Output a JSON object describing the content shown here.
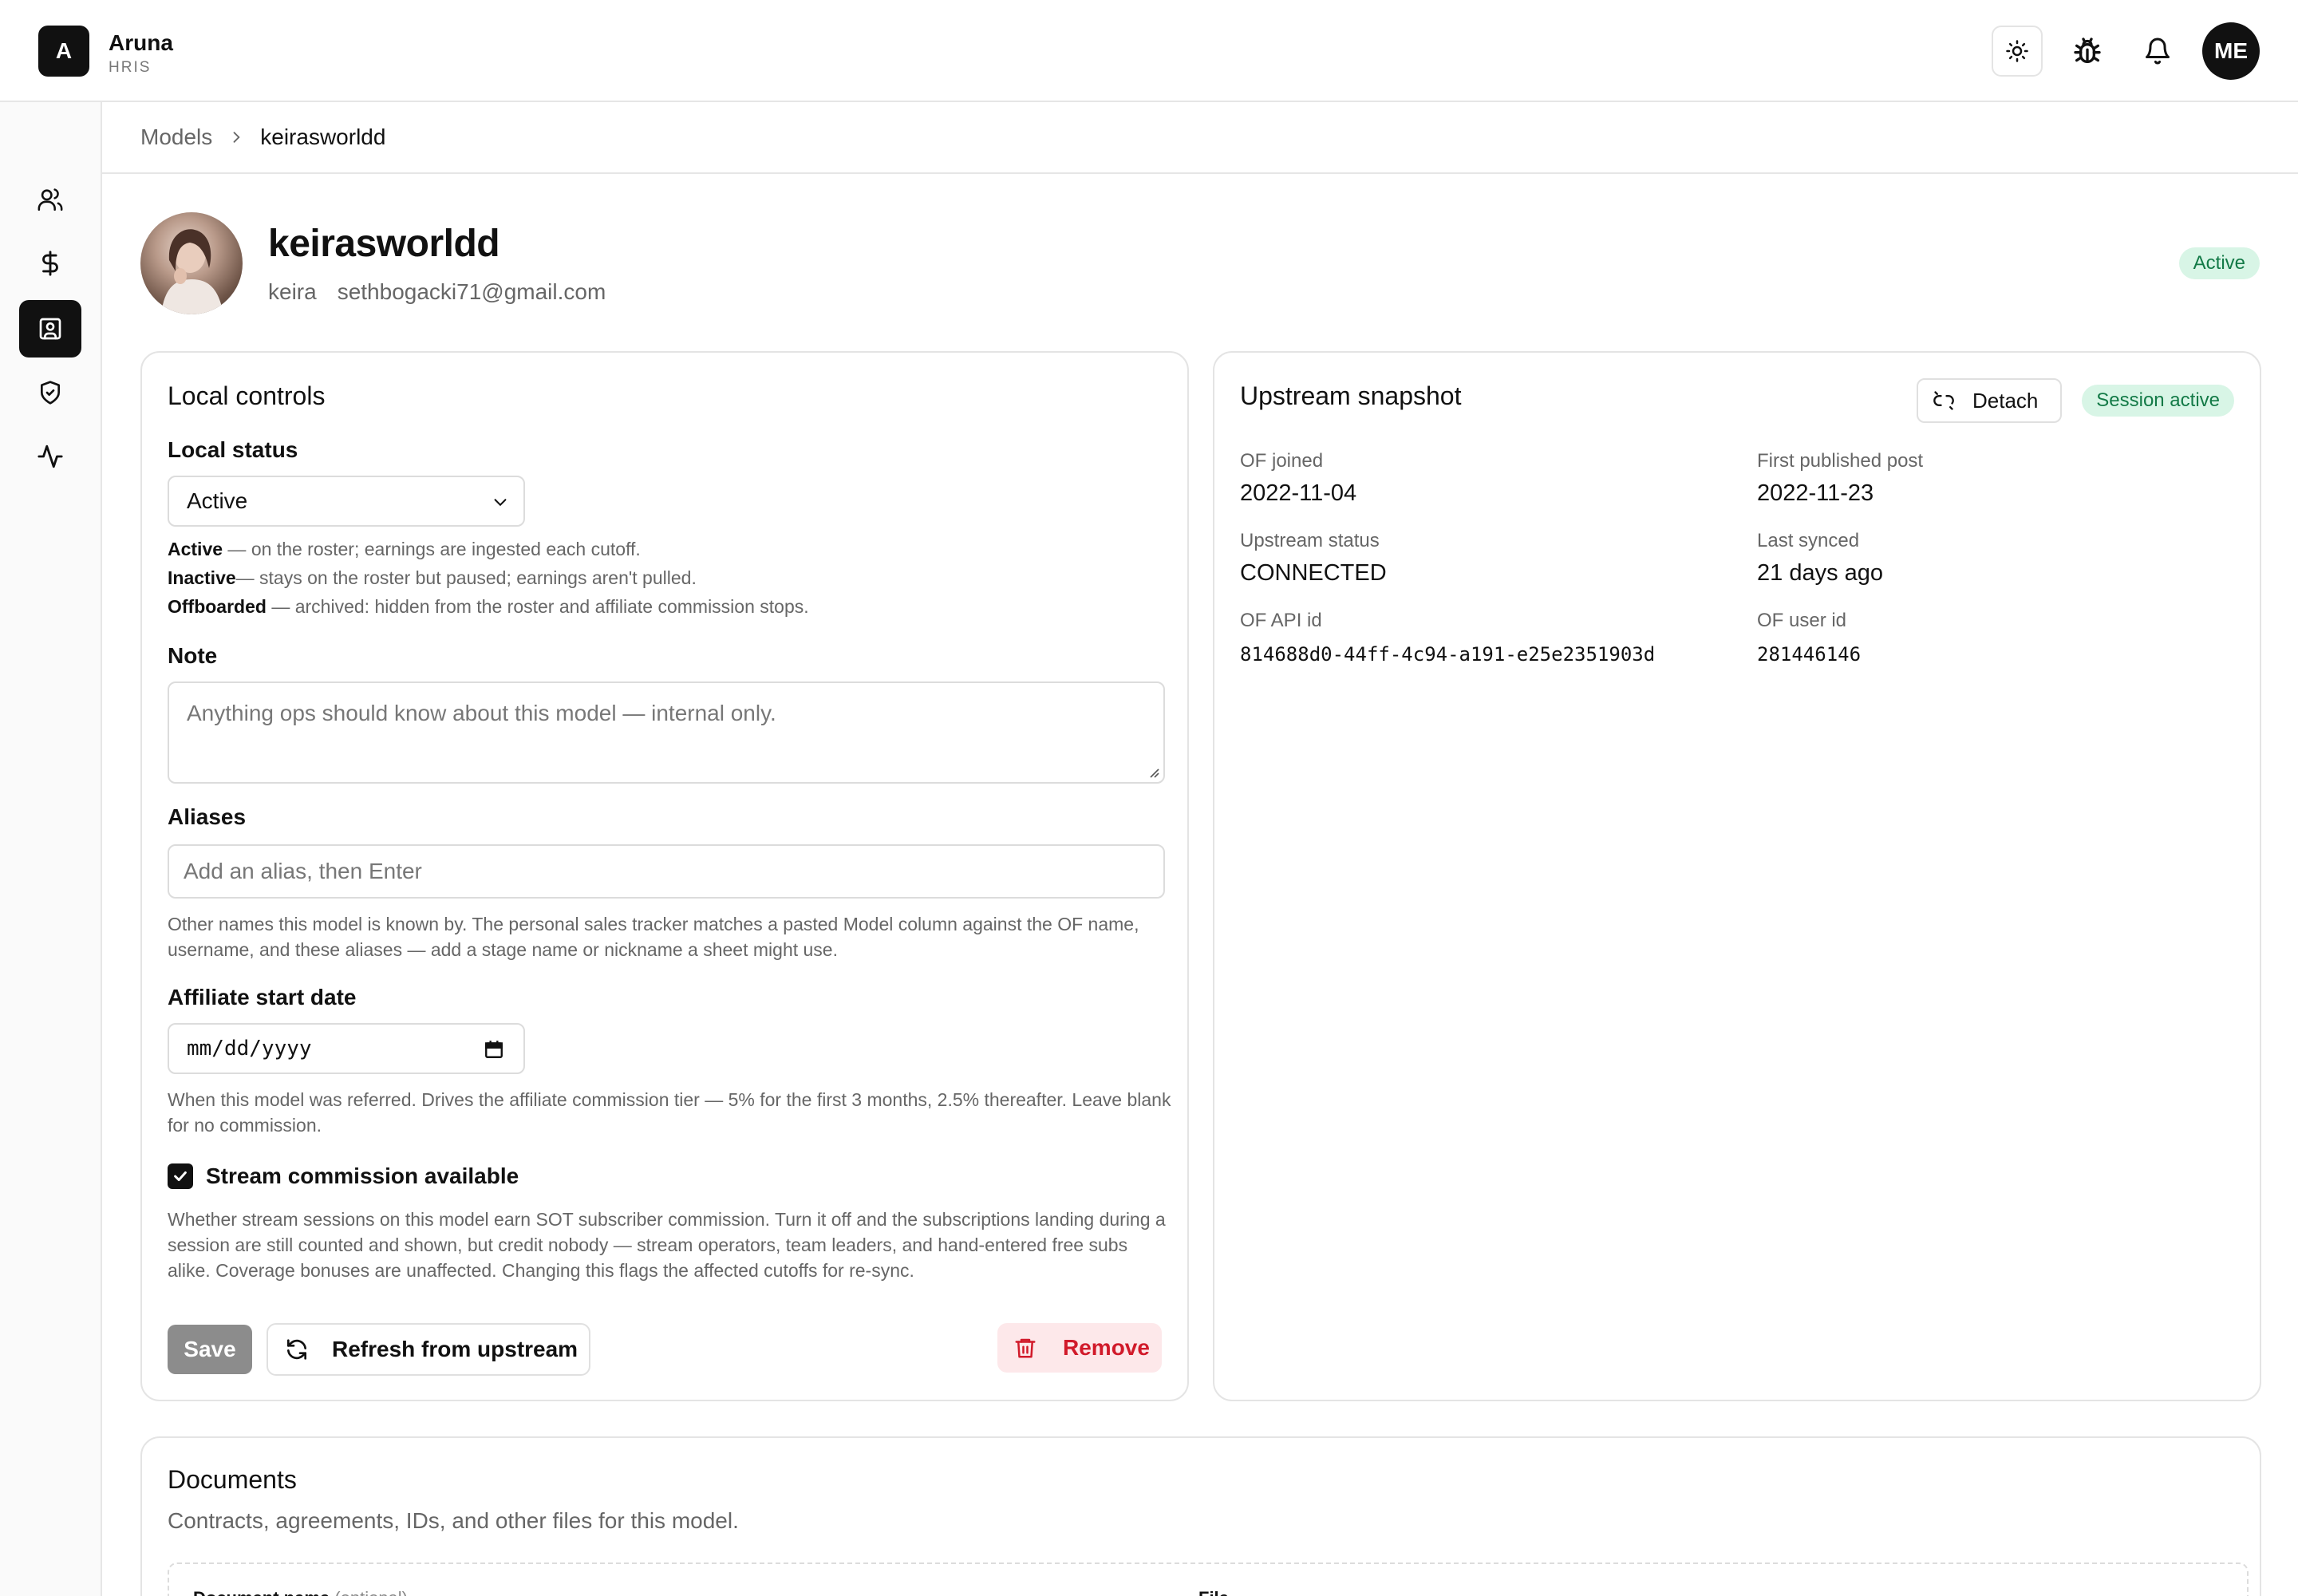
{
  "app": {
    "logo_letter": "A",
    "name": "Aruna",
    "subtitle": "HRIS"
  },
  "topbar": {
    "icons": [
      "sun-icon",
      "bug-icon",
      "bell-icon"
    ],
    "user_initials": "ME"
  },
  "sidebar": {
    "items": [
      {
        "icon": "users-icon",
        "active": false
      },
      {
        "icon": "dollar-icon",
        "active": false
      },
      {
        "icon": "contact-card-icon",
        "active": true
      },
      {
        "icon": "shield-check-icon",
        "active": false
      },
      {
        "icon": "activity-icon",
        "active": false
      }
    ]
  },
  "breadcrumb": {
    "parent": "Models",
    "current": "keirasworldd"
  },
  "model": {
    "username": "keirasworldd",
    "display_name": "keira",
    "email": "sethbogacki71@gmail.com",
    "status_badge": "Active"
  },
  "local_controls": {
    "title": "Local controls",
    "status_label": "Local status",
    "status_value": "Active",
    "status_help": [
      {
        "term": "Active",
        "desc": " — on the roster; earnings are ingested each cutoff."
      },
      {
        "term": "Inactive",
        "desc": "— stays on the roster but paused; earnings aren't pulled."
      },
      {
        "term": "Offboarded",
        "desc": " — archived: hidden from the roster and affiliate commission stops."
      }
    ],
    "note_label": "Note",
    "note_placeholder": "Anything ops should know about this model — internal only.",
    "aliases_label": "Aliases",
    "aliases_placeholder": "Add an alias, then Enter",
    "aliases_help": "Other names this model is known by. The personal sales tracker matches a pasted Model column against the OF name, username, and these aliases — add a stage name or nickname a sheet might use.",
    "affiliate_label": "Affiliate start date",
    "affiliate_placeholder": "mm/dd/yyyy",
    "affiliate_help": "When this model was referred. Drives the affiliate commission tier — 5% for the first 3 months, 2.5% thereafter. Leave blank for no commission.",
    "stream_label": "Stream commission available",
    "stream_checked": true,
    "stream_help": "Whether stream sessions on this model earn SOT subscriber commission. Turn it off and the subscriptions landing during a session are still counted and shown, but credit nobody — stream operators, team leaders, and hand-entered free subs alike. Coverage bonuses are unaffected. Changing this flags the affected cutoffs for re-sync.",
    "save_label": "Save",
    "refresh_label": "Refresh from upstream",
    "remove_label": "Remove"
  },
  "upstream": {
    "title": "Upstream snapshot",
    "detach_label": "Detach",
    "session_badge": "Session active",
    "of_joined_label": "OF joined",
    "of_joined": "2022-11-04",
    "first_post_label": "First published post",
    "first_post": "2022-11-23",
    "status_label": "Upstream status",
    "status": "CONNECTED",
    "last_synced_label": "Last synced",
    "last_synced": "21 days ago",
    "api_id_label": "OF API id",
    "api_id": "814688d0-44ff-4c94-a191-e25e2351903d",
    "user_id_label": "OF user id",
    "user_id": "281446146"
  },
  "documents": {
    "title": "Documents",
    "subtitle": "Contracts, agreements, IDs, and other files for this model.",
    "col_name": "Document name",
    "col_name_hint": "(optional)",
    "col_file": "File"
  },
  "colors": {
    "accent": "#111111",
    "success_bg": "#d8f5e6",
    "success_text": "#137a47",
    "danger_bg": "#fde8ea",
    "danger_text": "#d11a2a"
  }
}
